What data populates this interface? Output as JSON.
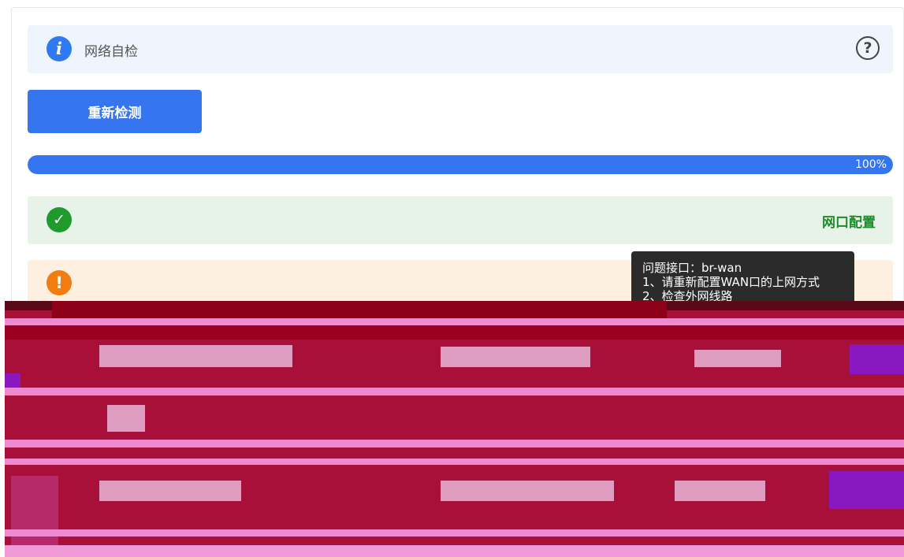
{
  "info_bar": {
    "title": "网络自检",
    "icon": "info-icon",
    "help_icon": "question-circle-icon"
  },
  "retest_button": {
    "label": "重新检测"
  },
  "progress": {
    "value": 100,
    "label": "100%"
  },
  "checks": [
    {
      "status": "ok",
      "icon": "check-circle-icon",
      "label": "网口配置"
    },
    {
      "status": "warning",
      "icon": "exclamation-circle-icon",
      "label": ""
    }
  ],
  "tooltip": {
    "lines": [
      "问题接口：br-wan",
      "1、请重新配置WAN口的上网方式",
      "2、检查外网线路"
    ]
  },
  "colors": {
    "primary": "#3575f0",
    "success": "#1f9a2d",
    "warning": "#f07c12",
    "info_bg": "#eef5fd",
    "success_bg": "#e7f3e8",
    "warning_bg": "#fdf0e1"
  }
}
